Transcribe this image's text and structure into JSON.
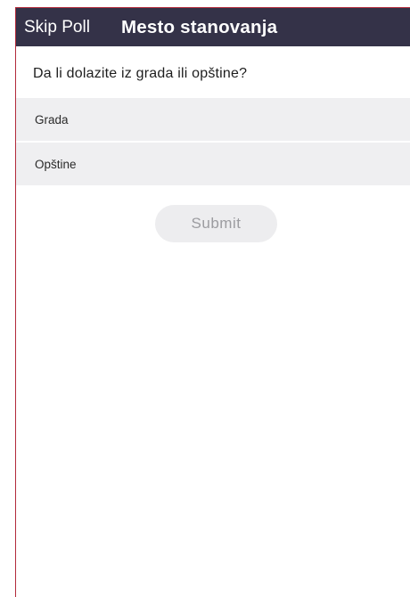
{
  "header": {
    "skip_label": "Skip Poll",
    "title": "Mesto stanovanja",
    "background_color": "#343248"
  },
  "poll": {
    "question": "Da li dolazite iz grada ili opštine?",
    "options": [
      {
        "label": "Grada",
        "selected": false
      },
      {
        "label": "Opštine",
        "selected": false
      }
    ],
    "submit_label": "Submit",
    "submit_enabled": false
  }
}
